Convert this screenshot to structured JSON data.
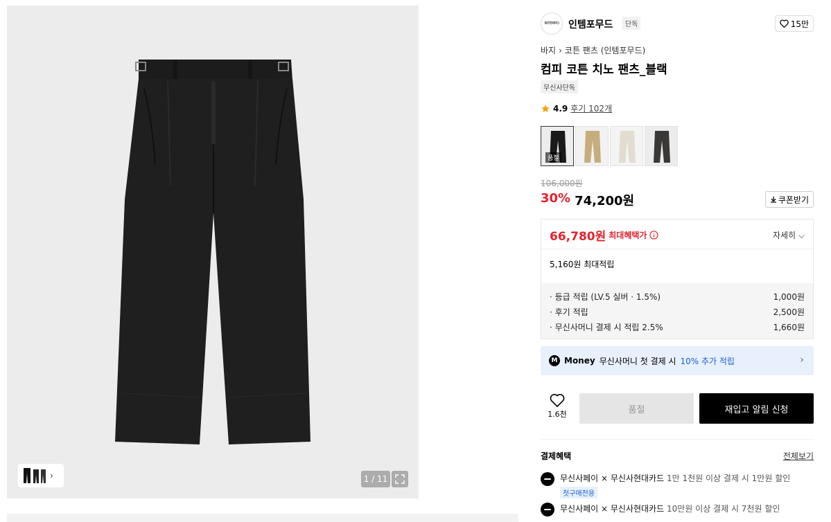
{
  "gallery": {
    "counter": "1 / 11"
  },
  "brand": {
    "logo_text": "INTEMPO",
    "name": "인템포무드",
    "badge": "단독",
    "like_count": "15만"
  },
  "breadcrumb": {
    "category": "바지",
    "subcategory": "코튼 팬츠 (인템포무드)"
  },
  "product": {
    "title": "컴피 코튼 치노 팬츠_블랙",
    "tag": "무신사단독",
    "rating": "4.9",
    "reviews": "후기 102개"
  },
  "colors": {
    "soldout_label": "품절",
    "swatches": [
      "#1a1a1a",
      "#c7ad7d",
      "#e7e3d8",
      "#3a3836"
    ]
  },
  "price": {
    "original": "106,000원",
    "discount": "30%",
    "sale": "74,200원",
    "coupon_label": "쿠폰받기"
  },
  "benefit": {
    "max_price": "66,780원",
    "max_label": "최대혜택가",
    "detail_label": "자세히",
    "points_summary": "5,160원 최대적립",
    "items": [
      {
        "label": "· 등급 적립 (LV.5 실버 · 1.5%)",
        "value": "1,000원"
      },
      {
        "label": "· 후기 적립",
        "value": "2,500원"
      },
      {
        "label": "· 무신사머니 결제 시 적립 2.5%",
        "value": "1,660원"
      }
    ]
  },
  "money": {
    "badge": "M",
    "word": "Money",
    "text": "무신사머니 첫 결제 시",
    "highlight": "10% 추가 적립"
  },
  "actions": {
    "wish_count": "1.6천",
    "soldout_button": "품절",
    "restock_button": "재입고 알림 신청"
  },
  "payment": {
    "title": "결제혜택",
    "view_all": "전체보기",
    "items": [
      {
        "card": "무신사페이 × 무신사현대카드",
        "desc": "1만 1천원 이상 결제 시 1만원 할인",
        "tag": "첫구매전용"
      },
      {
        "card": "무신사페이 × 무신사현대카드",
        "desc": "10만원 이상 결제 시 7천원 할인",
        "tag": ""
      }
    ]
  },
  "colors_theme": {
    "accent_red": "#e3232c",
    "accent_blue": "#1a5fd6"
  }
}
